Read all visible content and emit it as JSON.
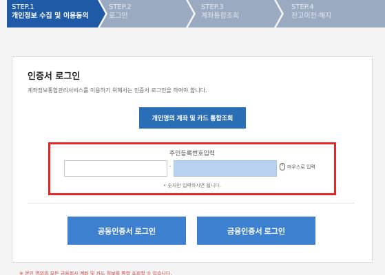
{
  "steps": [
    {
      "num": "STEP.1",
      "label": "개인정보 수집 및 이용동의"
    },
    {
      "num": "STEP.2",
      "label": "로그인"
    },
    {
      "num": "STEP.3",
      "label": "계좌통합조회"
    },
    {
      "num": "STEP.4",
      "label": "잔고이전·해지"
    }
  ],
  "colors": {
    "step_active": "#1f5aa6",
    "step_inactive": "#9aaac0",
    "primary_button": "#2a6fb6",
    "cert_button": "#3d80cf",
    "highlight_border": "#e32628"
  },
  "login": {
    "title": "인증서 로그인",
    "description": "계좌정보통합관리서비스를 이용하기 위해서는 인증서 로그인을 하여야 합니다.",
    "inquiry_button": "개인명의 계좌 및 카드 통합조회"
  },
  "rrn": {
    "label": "주민등록번호입력",
    "front_value": "",
    "dash": "-",
    "back_value": "",
    "mouse_input_label": "마우스로 입력",
    "mouse_icon": "mouse-icon",
    "hint": "• 숫자만 입력하시면 됩니다."
  },
  "cert_buttons": {
    "joint": "공동인증서 로그인",
    "financial": "금융인증서 로그인"
  },
  "footnote": "※ 본인 명의의 모든 금융회사 계좌 및 카드 정보를 통합 조회할 수 있습니다."
}
